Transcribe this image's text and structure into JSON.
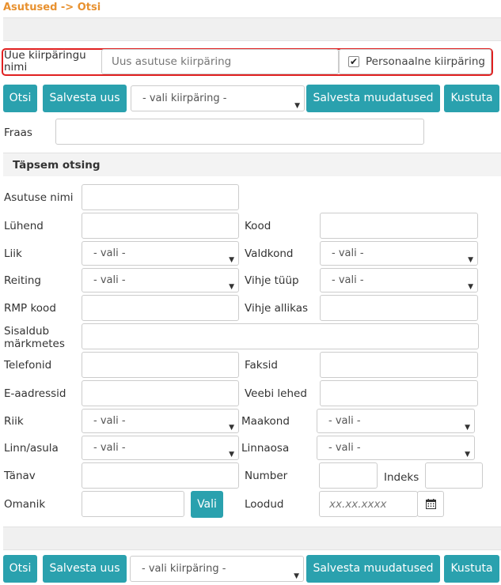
{
  "breadcrumb": "Asutused -> Otsi",
  "quick_search": {
    "name_label": "Uue kiirpäringu nimi",
    "name_placeholder": "Uus asutuse kiirpäring",
    "personal_label": "Personaalne kiirpäring",
    "personal_checked": true
  },
  "toolbar": {
    "search_label": "Otsi",
    "save_new_label": "Salvesta uus",
    "select_value": "- vali kiirpäring -",
    "save_changes_label": "Salvesta muudatused",
    "delete_label": "Kustuta"
  },
  "phrase": {
    "label": "Fraas",
    "value": ""
  },
  "advanced": {
    "title": "Täpsem otsing",
    "fields": {
      "institution_name": "Asutuse nimi",
      "abbreviation": "Lühend",
      "code": "Kood",
      "type": "Liik",
      "domain": "Valdkond",
      "rating": "Reiting",
      "tip_type": "Vihje tüüp",
      "rmp_code": "RMP kood",
      "tip_source": "Vihje allikas",
      "notes_contains": "Sisaldub märkmetes",
      "phone": "Telefonid",
      "fax": "Faksid",
      "email": "E-aadressid",
      "web": "Veebi lehed",
      "country": "Riik",
      "county": "Maakond",
      "city": "Linn/asula",
      "district": "Linnaosa",
      "street": "Tänav",
      "number": "Number",
      "postal_index": "Indeks",
      "owner": "Omanik",
      "created": "Loodud"
    },
    "select_default": "- vali -",
    "choose_button": "Vali",
    "date_placeholder": "xx.xx.xxxx"
  },
  "colors": {
    "accent": "#2aa1ae",
    "breadcrumb": "#e8912f",
    "highlight": "#e02020"
  }
}
